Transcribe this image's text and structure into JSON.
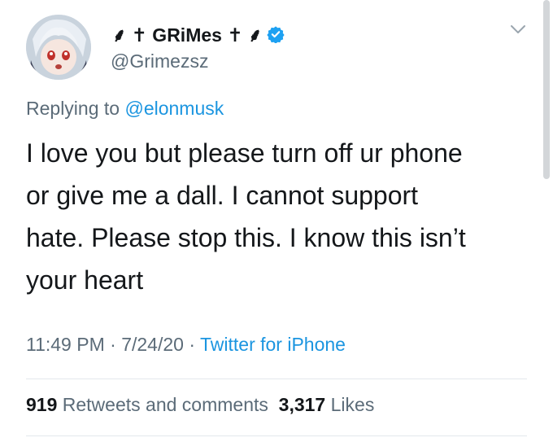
{
  "profile": {
    "display_name": "⸙ ✝ GRiMes ✝ ⸙",
    "handle": "@Grimezsz",
    "verified": true
  },
  "reply": {
    "prefix": "Replying to",
    "mention": "@elonmusk"
  },
  "tweet": {
    "lines": [
      "I love you but please turn off ur phone",
      "or give me a dall.  I cannot support",
      "hate.  Please stop this. I know this isn’t",
      "your heart"
    ]
  },
  "meta": {
    "time": "11:49 PM",
    "date": "7/24/20",
    "separator": "·",
    "source": "Twitter for iPhone"
  },
  "stats": {
    "retweets_count": "919",
    "retweets_label": "Retweets and comments",
    "likes_count": "3,317",
    "likes_label": "Likes"
  },
  "colors": {
    "link": "#1b95e0",
    "secondary_text": "#5b6b78",
    "primary_text": "#14171a"
  },
  "icons": {
    "verified": "verified-badge-icon",
    "menu": "chevron-down-icon"
  }
}
